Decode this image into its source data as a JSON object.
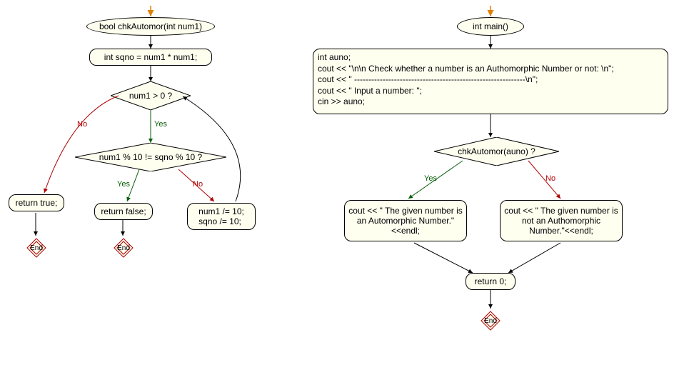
{
  "left": {
    "func_sig": "bool chkAutomor(int num1)",
    "stmt1": "int sqno = num1 * num1;",
    "cond1": "num1 > 0 ?",
    "cond2": "num1 % 10 != sqno % 10 ?",
    "ret_true": "return true;",
    "ret_false": "return false;",
    "update": "num1 /= 10;\nsqno /= 10;",
    "end1": "End",
    "end2": "End",
    "yes1": "Yes",
    "no1": "No",
    "yes2": "Yes",
    "no2": "No"
  },
  "right": {
    "func_sig": "int main()",
    "init_block": "int auno;\ncout << \"\\n\\n Check whether a number is an Authomorphic Number or not: \\n\";\ncout << \" ------------------------------------------------------------\\n\";\ncout << \" Input a number: \";\ncin >> auno;",
    "cond": "chkAutomor(auno) ?",
    "out_yes": "cout << \" The given number is an Automorphic Number.\"<<endl;",
    "out_no": "cout << \" The given number is not an Authomorphic Number.\"<<endl;",
    "ret0": "return 0;",
    "end": "End",
    "yes": "Yes",
    "no": "No"
  }
}
